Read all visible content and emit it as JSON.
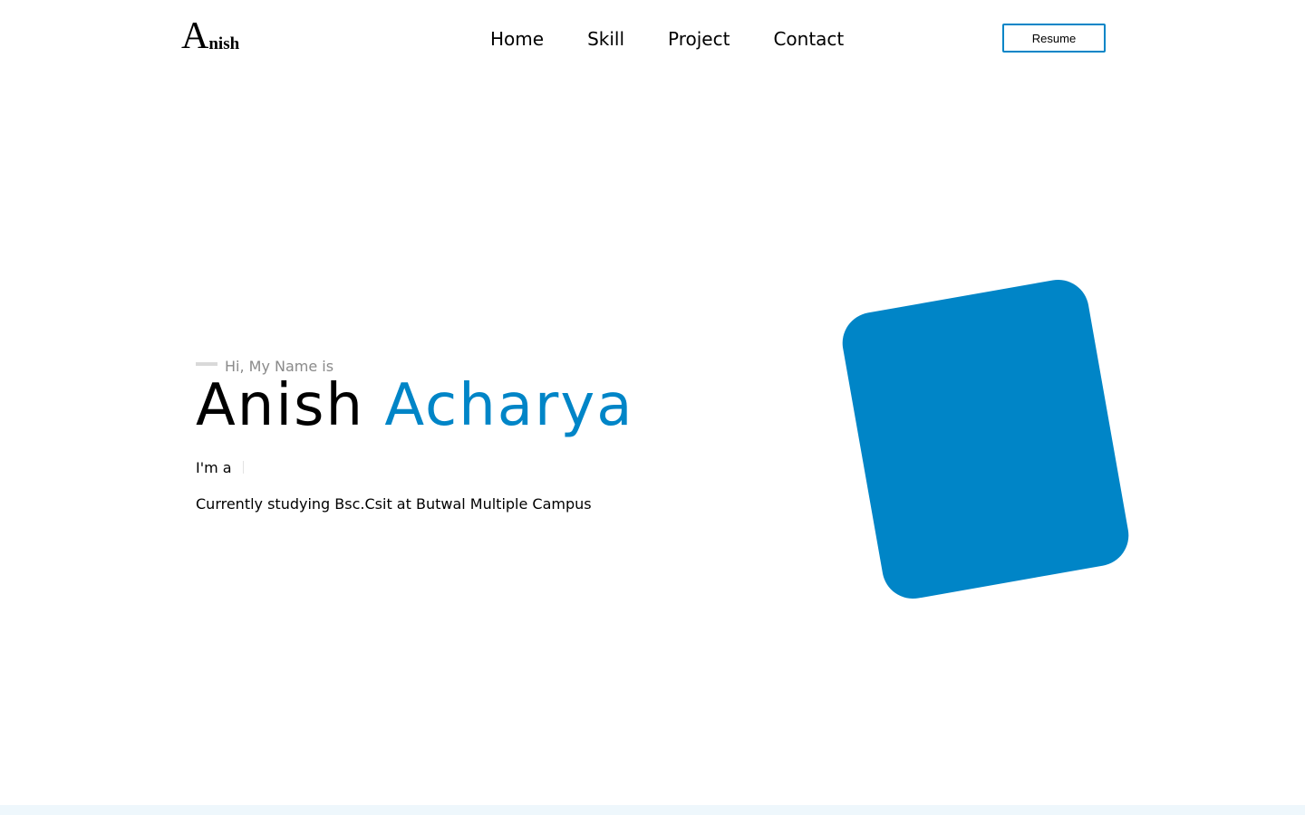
{
  "header": {
    "logo": {
      "initial": "A",
      "rest": "nish"
    },
    "nav": [
      {
        "label": "Home"
      },
      {
        "label": "Skill"
      },
      {
        "label": "Project"
      },
      {
        "label": "Contact"
      }
    ],
    "resume_label": "Resume"
  },
  "hero": {
    "greeting": "Hi, My Name is",
    "first_name": "Anish",
    "last_name": "Acharya",
    "role_prefix": "I'm a",
    "study": "Currently studying Bsc.Csit at Butwal Multiple Campus"
  },
  "colors": {
    "accent": "#0085c7",
    "muted_text": "#8a8a8a",
    "footer_strip": "#eef7fc"
  },
  "icons": {
    "greeting_line": "horizontal-dash",
    "hero_shape": "rounded-tilted-square"
  }
}
